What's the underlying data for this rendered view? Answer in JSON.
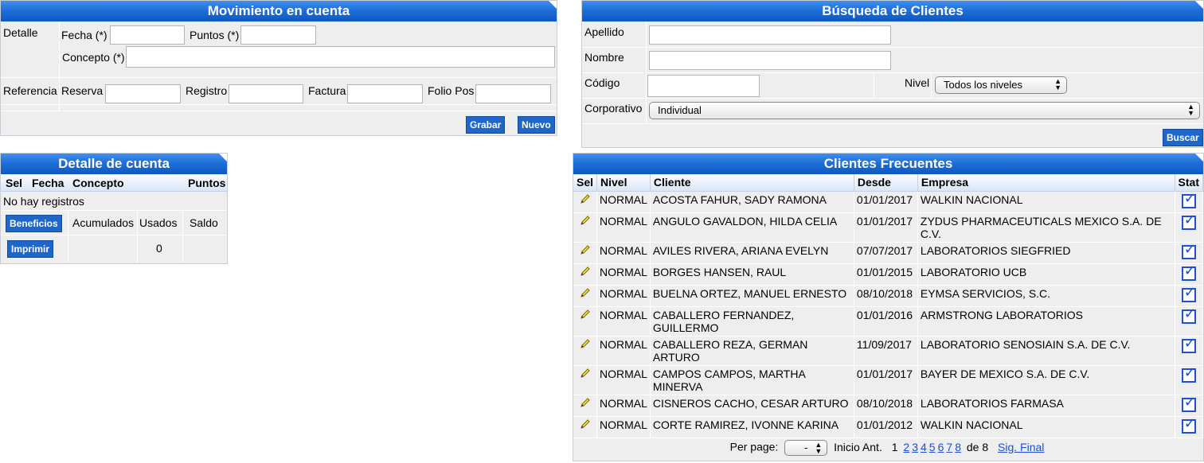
{
  "movimiento": {
    "title": "Movimiento en cuenta",
    "detalle_label": "Detalle",
    "fecha_label": "Fecha (*)",
    "puntos_label": "Puntos (*)",
    "concepto_label": "Concepto (*)",
    "referencia_label": "Referencia",
    "reserva_label": "Reserva",
    "registro_label": "Registro",
    "factura_label": "Factura",
    "folio_label": "Folio Pos",
    "grabar": "Grabar",
    "nuevo": "Nuevo"
  },
  "detalle_cuenta": {
    "title": "Detalle de cuenta",
    "headers": [
      "Sel",
      "Fecha",
      "Concepto",
      "Puntos"
    ],
    "empty": "No hay registros",
    "beneficios": "Beneficios",
    "acumulados": "Acumulados",
    "usados": "Usados",
    "saldo": "Saldo",
    "imprimir": "Imprimir",
    "usados_value": "0"
  },
  "busqueda": {
    "title": "Búsqueda de Clientes",
    "apellido_label": "Apellido",
    "nombre_label": "Nombre",
    "codigo_label": "Código",
    "nivel_label": "Nivel",
    "nivel_value": "Todos los niveles",
    "corporativo_label": "Corporativo",
    "corporativo_value": "Individual",
    "buscar": "Buscar"
  },
  "frecuentes": {
    "title": "Clientes Frecuentes",
    "headers": [
      "Sel",
      "Nivel",
      "Cliente",
      "Desde",
      "Empresa",
      "Stat"
    ],
    "rows": [
      {
        "nivel": "NORMAL",
        "cliente": "ACOSTA FAHUR, SADY RAMONA",
        "desde": "01/01/2017",
        "empresa": "WALKIN NACIONAL"
      },
      {
        "nivel": "NORMAL",
        "cliente": "ANGULO GAVALDON, HILDA CELIA",
        "desde": "01/01/2017",
        "empresa": "ZYDUS PHARMACEUTICALS MEXICO S.A. DE C.V."
      },
      {
        "nivel": "NORMAL",
        "cliente": "AVILES RIVERA, ARIANA EVELYN",
        "desde": "07/07/2017",
        "empresa": "LABORATORIOS SIEGFRIED"
      },
      {
        "nivel": "NORMAL",
        "cliente": "BORGES HANSEN, RAUL",
        "desde": "01/01/2015",
        "empresa": "LABORATORIO UCB"
      },
      {
        "nivel": "NORMAL",
        "cliente": "BUELNA ORTEZ, MANUEL ERNESTO",
        "desde": "08/10/2018",
        "empresa": "EYMSA SERVICIOS, S.C."
      },
      {
        "nivel": "NORMAL",
        "cliente": "CABALLERO FERNANDEZ, GUILLERMO",
        "desde": "01/01/2016",
        "empresa": "ARMSTRONG LABORATORIOS"
      },
      {
        "nivel": "NORMAL",
        "cliente": "CABALLERO REZA, GERMAN ARTURO",
        "desde": "11/09/2017",
        "empresa": "LABORATORIO SENOSIAIN S.A. DE C.V."
      },
      {
        "nivel": "NORMAL",
        "cliente": "CAMPOS CAMPOS, MARTHA MINERVA",
        "desde": "01/01/2017",
        "empresa": "BAYER DE MEXICO S.A. DE C.V."
      },
      {
        "nivel": "NORMAL",
        "cliente": "CISNEROS CACHO, CESAR ARTURO",
        "desde": "08/10/2018",
        "empresa": "LABORATORIOS FARMASA"
      },
      {
        "nivel": "NORMAL",
        "cliente": "CORTE RAMIREZ, IVONNE KARINA",
        "desde": "01/01/2012",
        "empresa": "WALKIN NACIONAL"
      }
    ],
    "pager": {
      "per_page_label": "Per page:",
      "per_page_value": "-",
      "inicio_ant": "Inicio Ant.",
      "current": "1",
      "pages": [
        "2",
        "3",
        "4",
        "5",
        "6",
        "7",
        "8"
      ],
      "of_label": "de 8",
      "next": "Sig. Final"
    }
  },
  "colors": {
    "header_blue": "#1f6fd8",
    "panel_bg": "#eeeeee",
    "button_blue": "#1e66c8",
    "link_blue": "#1a4fd6"
  },
  "icons": {
    "edit": "pencil-icon",
    "status": "checkbox-checked-icon"
  }
}
